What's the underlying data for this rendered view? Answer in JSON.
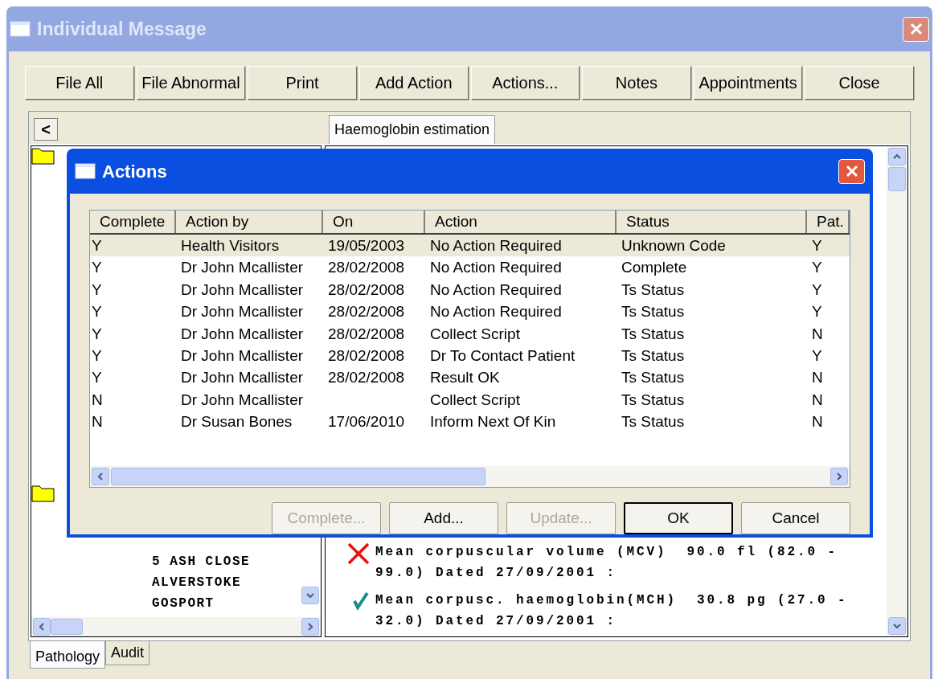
{
  "window": {
    "title": "Individual Message",
    "active": false
  },
  "toolbar": [
    {
      "label": "File All"
    },
    {
      "label": "File Abnormal"
    },
    {
      "label": "Print"
    },
    {
      "label": "Add Action"
    },
    {
      "label": "Actions..."
    },
    {
      "label": "Notes"
    },
    {
      "label": "Appointments"
    },
    {
      "label": "Close"
    }
  ],
  "nav_button": "<",
  "top_tabs": [
    {
      "label": "Haemoglobin estimation",
      "selected": true
    }
  ],
  "address_lines": [
    "5 ASH CLOSE",
    "ALVERSTOKE",
    "GOSPORT"
  ],
  "results": [
    {
      "kind": "abnormal",
      "text": "Mean corpuscular volume (MCV)  90.0 fl (82.0 - 99.0) Dated 27/09/2001 :"
    },
    {
      "kind": "normal",
      "text": "Mean corpusc. haemoglobin(MCH)  30.8 pg (27.0 - 32.0) Dated 27/09/2001 :"
    }
  ],
  "bottom_tabs": [
    {
      "label": "Pathology",
      "selected": true
    },
    {
      "label": "Audit",
      "selected": false
    }
  ],
  "dialog": {
    "title": "Actions",
    "columns": [
      "Complete",
      "Action by",
      "On",
      "Action",
      "Status",
      "Pat."
    ],
    "rows": [
      {
        "cells": [
          "Y",
          "Health Visitors",
          "19/05/2003",
          "No Action Required",
          "Unknown Code",
          "Y"
        ],
        "selected": true
      },
      {
        "cells": [
          "Y",
          "Dr John Mcallister",
          "28/02/2008",
          "No Action Required",
          "Complete",
          "Y"
        ],
        "selected": false
      },
      {
        "cells": [
          "Y",
          "Dr John Mcallister",
          "28/02/2008",
          "No Action Required",
          "Ts Status",
          "Y"
        ],
        "selected": false
      },
      {
        "cells": [
          "Y",
          "Dr John Mcallister",
          "28/02/2008",
          "No Action Required",
          "Ts Status",
          "Y"
        ],
        "selected": false
      },
      {
        "cells": [
          "Y",
          "Dr John Mcallister",
          "28/02/2008",
          "Collect Script",
          "Ts Status",
          "N"
        ],
        "selected": false
      },
      {
        "cells": [
          "Y",
          "Dr John Mcallister",
          "28/02/2008",
          "Dr To Contact Patient",
          "Ts Status",
          "Y"
        ],
        "selected": false
      },
      {
        "cells": [
          "Y",
          "Dr John Mcallister",
          "28/02/2008",
          "Result OK",
          "Ts Status",
          "N"
        ],
        "selected": false
      },
      {
        "cells": [
          "N",
          "Dr John Mcallister",
          "",
          "Collect Script",
          "Ts Status",
          "N"
        ],
        "selected": false
      },
      {
        "cells": [
          "N",
          "Dr Susan Bones",
          "17/06/2010",
          "Inform Next Of Kin",
          "Ts Status",
          "N"
        ],
        "selected": false
      }
    ],
    "buttons": [
      {
        "label": "Complete...",
        "disabled": true,
        "default": false
      },
      {
        "label": "Add...",
        "disabled": false,
        "default": false
      },
      {
        "label": "Update...",
        "disabled": true,
        "default": false
      },
      {
        "label": "OK",
        "disabled": false,
        "default": true
      },
      {
        "label": "Cancel",
        "disabled": false,
        "default": false
      }
    ]
  }
}
